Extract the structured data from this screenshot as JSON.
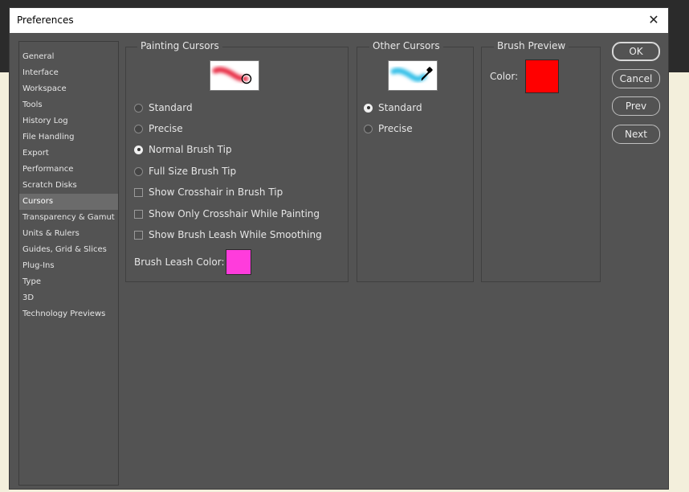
{
  "window": {
    "title": "Preferences",
    "close_glyph": "✕"
  },
  "sidebar": {
    "items": [
      {
        "label": "General",
        "active": false
      },
      {
        "label": "Interface",
        "active": false
      },
      {
        "label": "Workspace",
        "active": false
      },
      {
        "label": "Tools",
        "active": false
      },
      {
        "label": "History Log",
        "active": false
      },
      {
        "label": "File Handling",
        "active": false
      },
      {
        "label": "Export",
        "active": false
      },
      {
        "label": "Performance",
        "active": false
      },
      {
        "label": "Scratch Disks",
        "active": false
      },
      {
        "label": "Cursors",
        "active": true
      },
      {
        "label": "Transparency & Gamut",
        "active": false
      },
      {
        "label": "Units & Rulers",
        "active": false
      },
      {
        "label": "Guides, Grid & Slices",
        "active": false
      },
      {
        "label": "Plug-Ins",
        "active": false
      },
      {
        "label": "Type",
        "active": false
      },
      {
        "label": "3D",
        "active": false
      },
      {
        "label": "Technology Previews",
        "active": false
      }
    ]
  },
  "painting_cursors": {
    "title": "Painting Cursors",
    "preview_icon": "red-brush-stroke-icon",
    "options": [
      {
        "label": "Standard",
        "selected": false
      },
      {
        "label": "Precise",
        "selected": false
      },
      {
        "label": "Normal Brush Tip",
        "selected": true
      },
      {
        "label": "Full Size Brush Tip",
        "selected": false
      }
    ],
    "checkboxes": [
      {
        "label": "Show Crosshair in Brush Tip",
        "checked": false
      },
      {
        "label": "Show Only Crosshair While Painting",
        "checked": false
      },
      {
        "label": "Show Brush Leash While Smoothing",
        "checked": false
      }
    ],
    "leash_color_label": "Brush Leash Color:",
    "leash_color": "#ff3cdc"
  },
  "other_cursors": {
    "title": "Other Cursors",
    "preview_icon": "eyedropper-icon",
    "options": [
      {
        "label": "Standard",
        "selected": true
      },
      {
        "label": "Precise",
        "selected": false
      }
    ]
  },
  "brush_preview": {
    "title": "Brush Preview",
    "color_label": "Color:",
    "color": "#ff0000"
  },
  "buttons": {
    "ok": "OK",
    "cancel": "Cancel",
    "prev": "Prev",
    "next": "Next"
  }
}
